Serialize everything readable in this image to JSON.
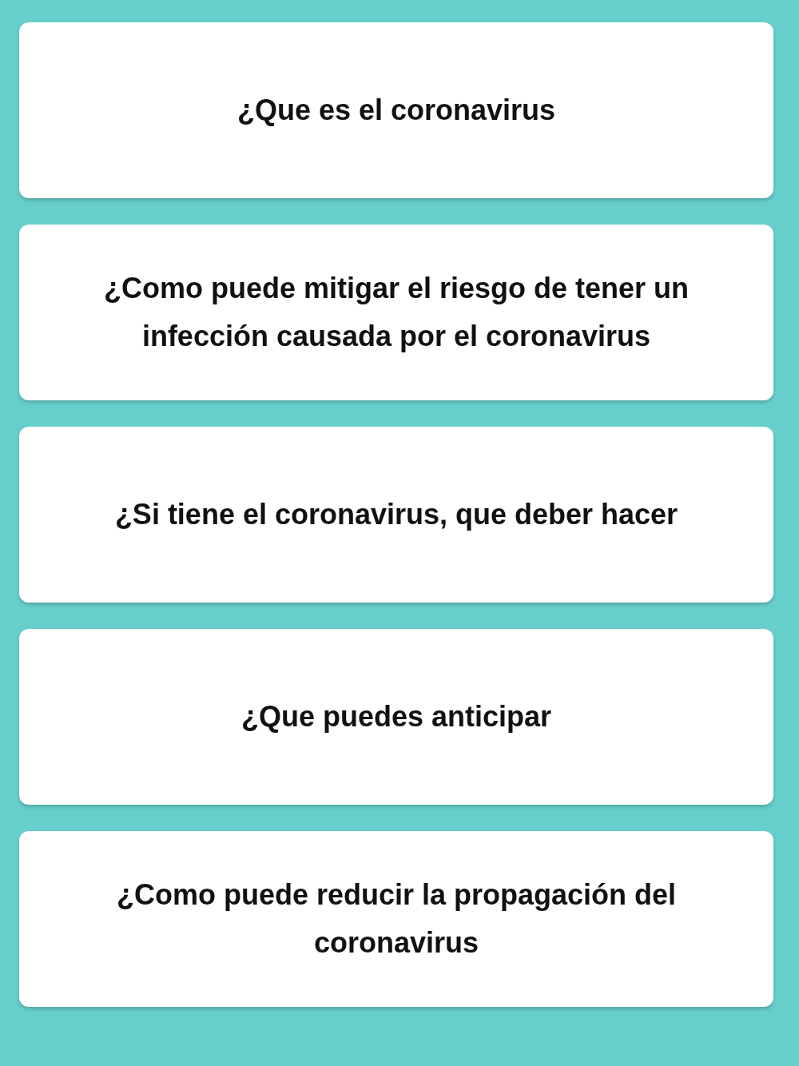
{
  "questions": [
    {
      "label": "¿Que es el coronavirus"
    },
    {
      "label": "¿Como puede mitigar el riesgo de tener un infección causada por el coronavirus"
    },
    {
      "label": "¿Si tiene el coronavirus, que deber hacer"
    },
    {
      "label": "¿Que puedes anticipar"
    },
    {
      "label": "¿Como puede reducir la propagación del coronavirus"
    }
  ]
}
